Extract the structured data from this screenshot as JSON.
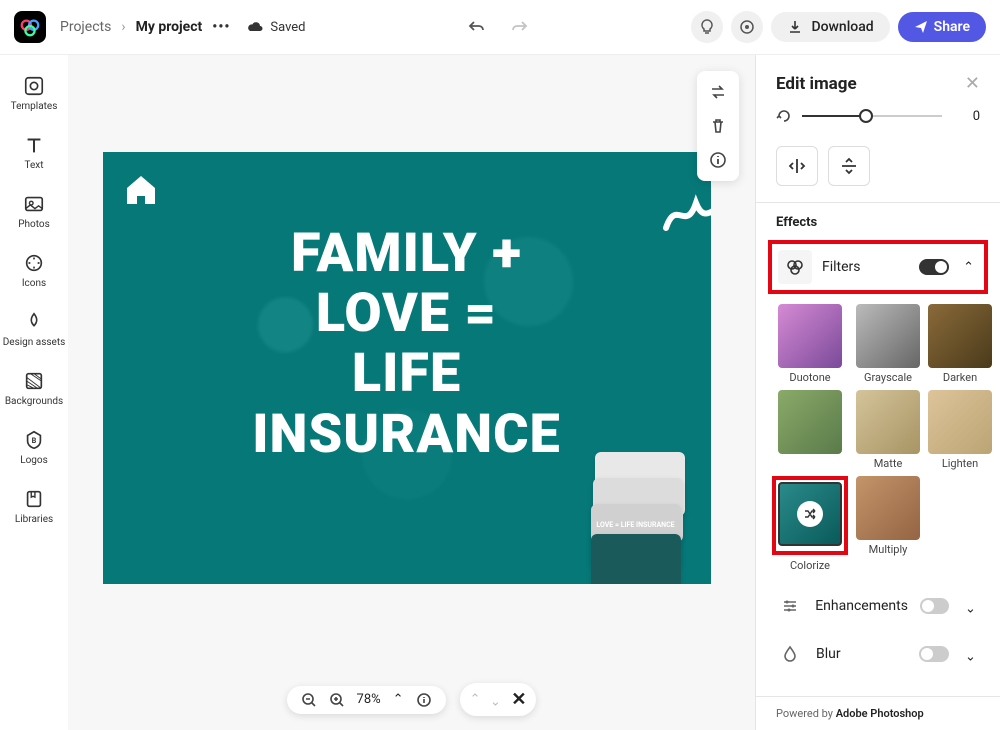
{
  "header": {
    "breadcrumb_root": "Projects",
    "breadcrumb_current": "My project",
    "saved_label": "Saved",
    "download_label": "Download",
    "share_label": "Share"
  },
  "sidebar": {
    "items": [
      {
        "label": "Templates"
      },
      {
        "label": "Text"
      },
      {
        "label": "Photos"
      },
      {
        "label": "Icons"
      },
      {
        "label": "Design assets"
      },
      {
        "label": "Backgrounds"
      },
      {
        "label": "Logos"
      },
      {
        "label": "Libraries"
      }
    ]
  },
  "canvas": {
    "line1": "FAMILY +",
    "line2": "LOVE =",
    "line3": "LIFE",
    "line4": "INSURANCE",
    "mini_text": "LOVE = LIFE INSURANCE",
    "zoom": "78%"
  },
  "panel": {
    "title": "Edit image",
    "slider_value": "0",
    "effects_label": "Effects",
    "filters_label": "Filters",
    "filters": [
      {
        "name": "Duotone"
      },
      {
        "name": "Grayscale"
      },
      {
        "name": "Darken"
      },
      {
        "name": ""
      },
      {
        "name": "Matte"
      },
      {
        "name": "Lighten"
      },
      {
        "name": "Colorize"
      },
      {
        "name": "Multiply"
      }
    ],
    "enhancements_label": "Enhancements",
    "blur_label": "Blur",
    "powered_prefix": "Powered by ",
    "powered_by": "Adobe Photoshop"
  }
}
